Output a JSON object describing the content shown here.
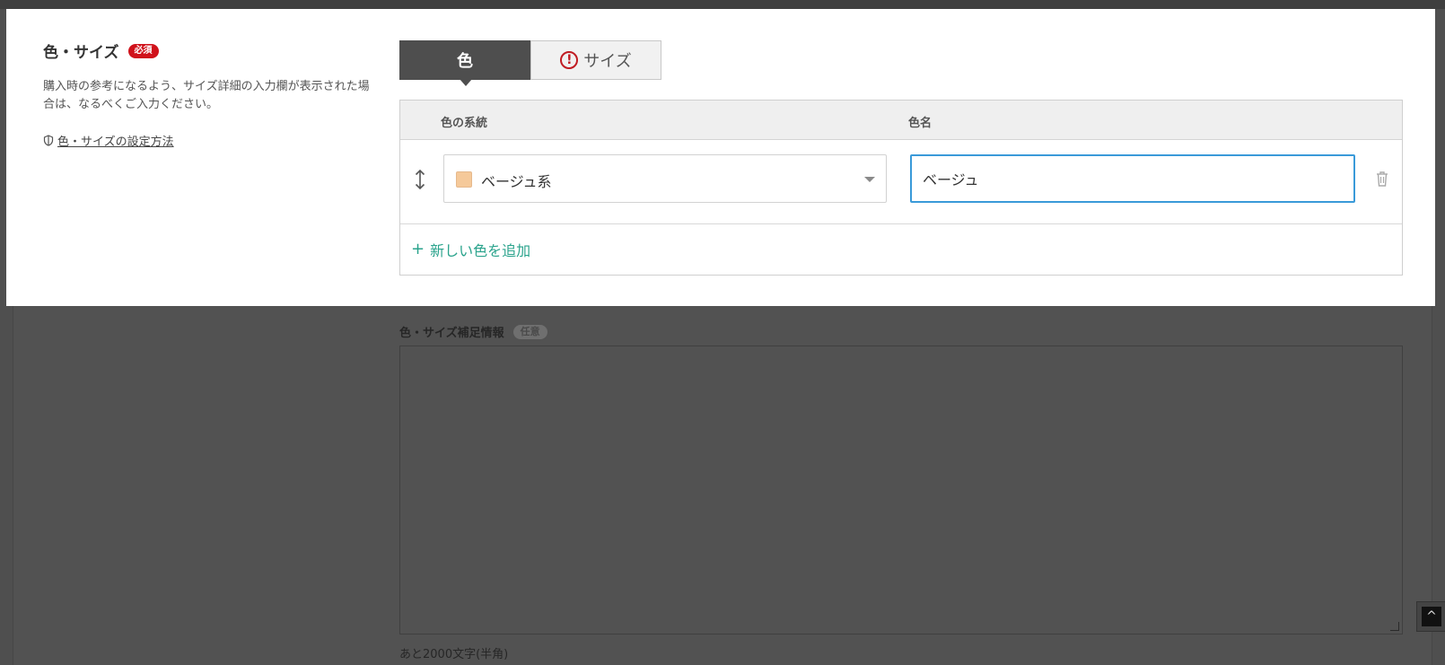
{
  "section": {
    "title": "色・サイズ",
    "required_badge": "必須",
    "description": "購入時の参考になるよう、サイズ詳細の入力欄が表示された場合は、なるべくご入力ください。",
    "help_link": "色・サイズの設定方法"
  },
  "tabs": [
    {
      "label": "色",
      "active": true,
      "warning": false
    },
    {
      "label": "サイズ",
      "active": false,
      "warning": true
    }
  ],
  "color_table": {
    "headers": {
      "family": "色の系統",
      "name": "色名"
    },
    "rows": [
      {
        "family": "ベージュ系",
        "swatch_color": "#f5c99a",
        "name": "ベージュ"
      }
    ],
    "add_label": "新しい色を追加",
    "add_icon": "+"
  },
  "supplement": {
    "label": "色・サイズ補足情報",
    "optional_badge": "任意",
    "counter": "あと2000文字(半角)"
  },
  "colors": {
    "accent_link": "#2aa38c",
    "required_red": "#d0121b",
    "input_focus": "#3a9ad9",
    "tab_active": "#4e4e4e"
  },
  "icons": {
    "warning": "warning-icon",
    "drag": "drag-handle-icon",
    "trash": "trash-icon",
    "help": "shield-icon",
    "caret": "caret-down-icon",
    "page_top": "arrow-up-icon"
  }
}
